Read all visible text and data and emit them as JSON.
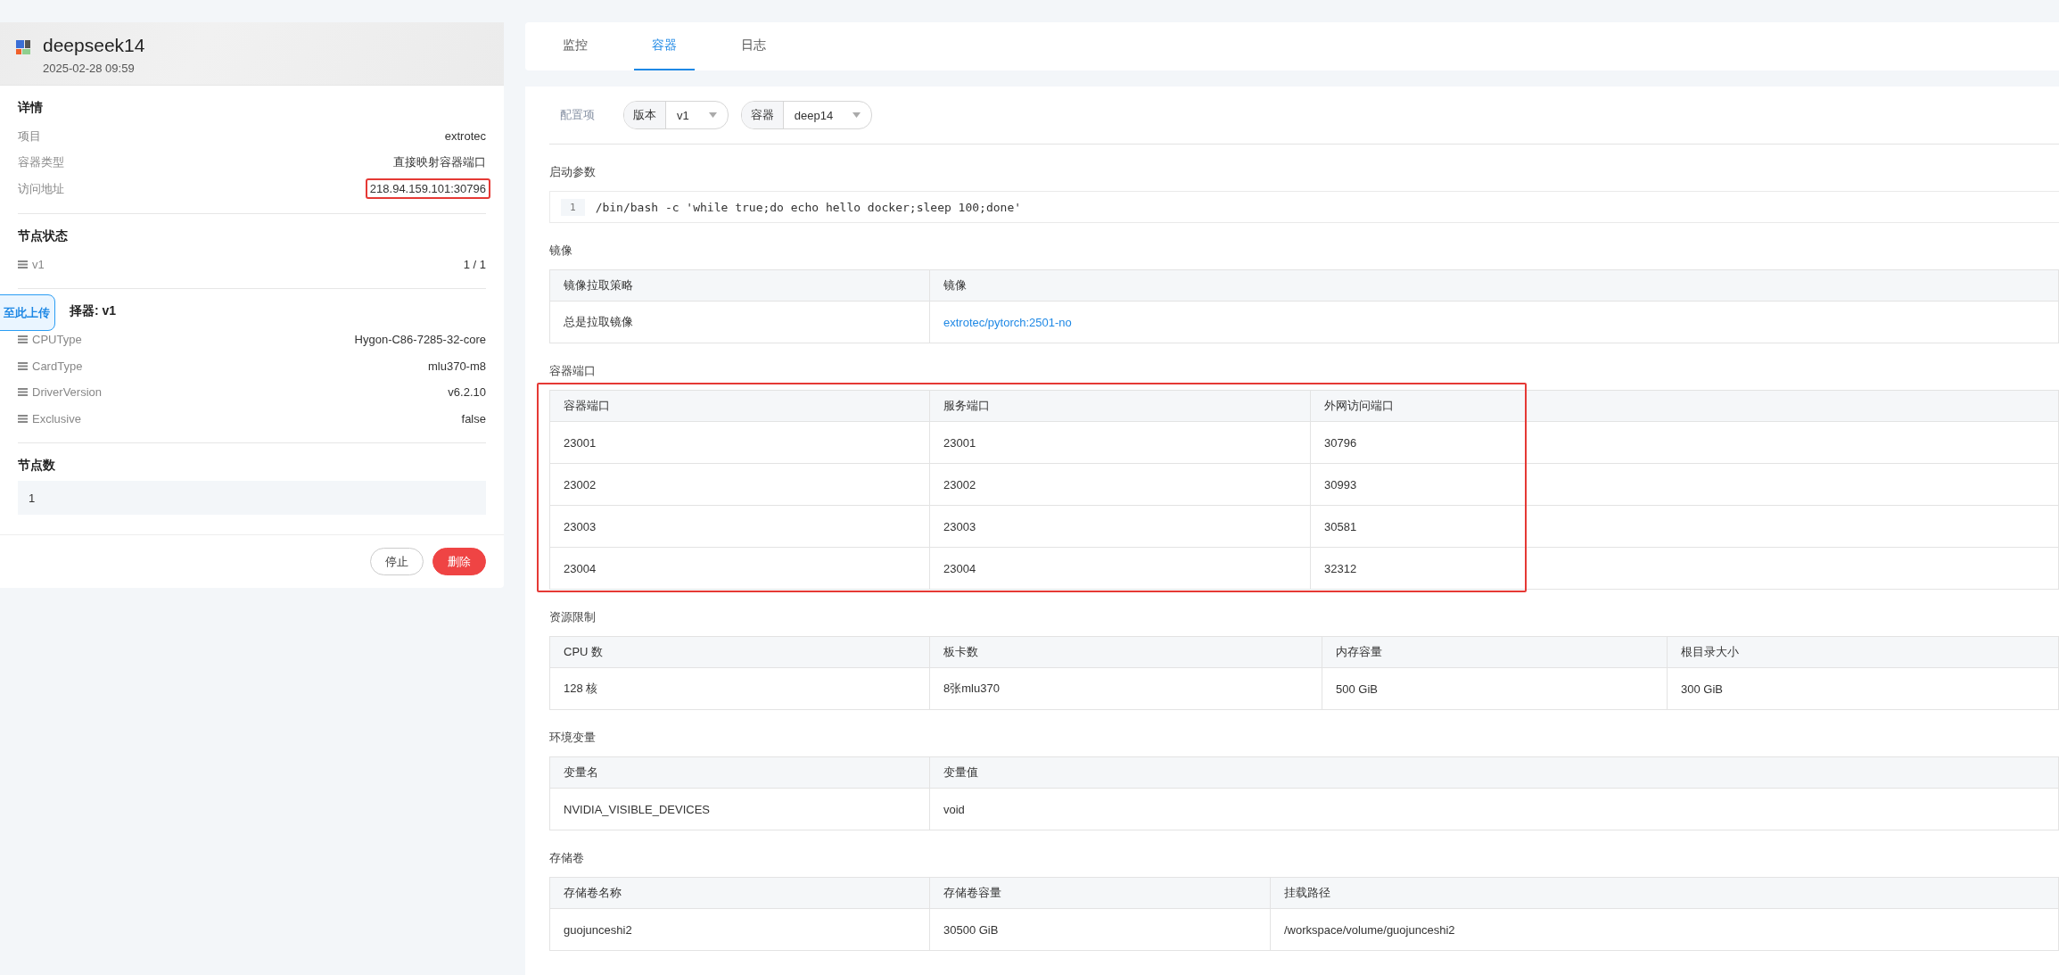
{
  "app": {
    "name": "deepseek14",
    "created": "2025-02-28 09:59"
  },
  "details": {
    "title": "详情",
    "rows": [
      {
        "label": "项目",
        "value": "extrotec",
        "highlighted": false
      },
      {
        "label": "容器类型",
        "value": "直接映射容器端口",
        "highlighted": false
      },
      {
        "label": "访问地址",
        "value": "218.94.159.101:30796",
        "highlighted": true
      }
    ]
  },
  "node_status": {
    "title": "节点状态",
    "rows": [
      {
        "label": "v1",
        "value": "1 / 1"
      }
    ]
  },
  "selector": {
    "title": "择器: v1",
    "rows": [
      {
        "label": "CPUType",
        "value": "Hygon-C86-7285-32-core"
      },
      {
        "label": "CardType",
        "value": "mlu370-m8"
      },
      {
        "label": "DriverVersion",
        "value": "v6.2.10"
      },
      {
        "label": "Exclusive",
        "value": "false"
      }
    ]
  },
  "node_count": {
    "title": "节点数",
    "value": "1"
  },
  "floating_button": {
    "label": "至此上传"
  },
  "actions": [
    {
      "label": "停止",
      "kind": "default"
    },
    {
      "label": "删除",
      "kind": "danger"
    }
  ],
  "tabs": [
    {
      "label": "监控",
      "selected": false
    },
    {
      "label": "容器",
      "selected": true
    },
    {
      "label": "日志",
      "selected": false
    }
  ],
  "config": {
    "label": "配置项",
    "selects": [
      {
        "label": "版本",
        "value": "v1"
      },
      {
        "label": "容器",
        "value": "deep14"
      }
    ]
  },
  "sections": [
    {
      "title": "启动参数",
      "kind": "code",
      "lines": [
        {
          "number": "1",
          "text": "/bin/bash -c 'while true;do echo hello docker;sleep 100;done'"
        }
      ]
    },
    {
      "title": "镜像",
      "kind": "table",
      "highlighted": false,
      "columns": [
        "镜像拉取策略",
        "镜像"
      ],
      "rows": [
        [
          "总是拉取镜像",
          {
            "text": "extrotec/pytorch:2501-no",
            "link": true
          }
        ]
      ]
    },
    {
      "title": "容器端口",
      "kind": "table",
      "highlighted": true,
      "columns": [
        "容器端口",
        "服务端口",
        "外网访问端口"
      ],
      "rows": [
        [
          "23001",
          "23001",
          "30796"
        ],
        [
          "23002",
          "23002",
          "30993"
        ],
        [
          "23003",
          "23003",
          "30581"
        ],
        [
          "23004",
          "23004",
          "32312"
        ]
      ]
    },
    {
      "title": "资源限制",
      "kind": "table",
      "highlighted": false,
      "columns": [
        "CPU 数",
        "板卡数",
        "内存容量",
        "根目录大小"
      ],
      "rows": [
        [
          "128 核",
          "8张mlu370",
          "500 GiB",
          "300 GiB"
        ]
      ]
    },
    {
      "title": "环境变量",
      "kind": "table",
      "highlighted": false,
      "columns": [
        "变量名",
        "变量值"
      ],
      "rows": [
        [
          "NVIDIA_VISIBLE_DEVICES",
          "void"
        ]
      ]
    },
    {
      "title": "存储卷",
      "kind": "table",
      "highlighted": false,
      "columns": [
        "存储卷名称",
        "存储卷容量",
        "挂载路径"
      ],
      "rows": [
        [
          "guojunceshi2",
          "30500 GiB",
          "/workspace/volume/guojunceshi2"
        ]
      ]
    }
  ]
}
